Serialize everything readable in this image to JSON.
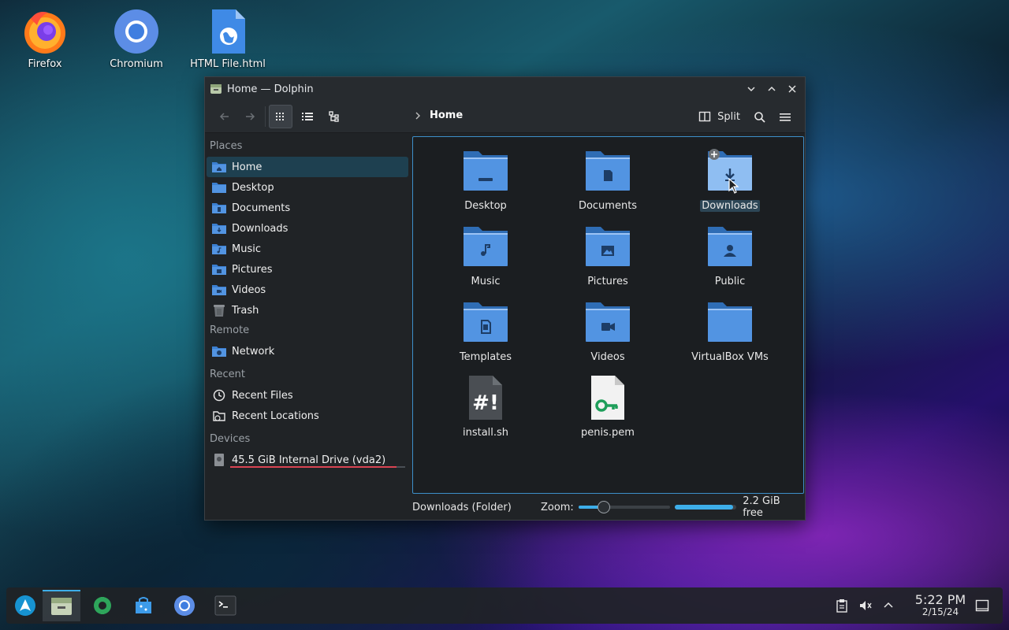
{
  "desktop": {
    "icons": [
      {
        "label": "Firefox"
      },
      {
        "label": "Chromium"
      },
      {
        "label": "HTML File.html"
      }
    ]
  },
  "window": {
    "title": "Home — Dolphin",
    "breadcrumb": "Home",
    "split_label": "Split",
    "sidebar": {
      "places_header": "Places",
      "places": [
        {
          "label": "Home",
          "icon": "home-folder-icon"
        },
        {
          "label": "Desktop",
          "icon": "desktop-folder-icon"
        },
        {
          "label": "Documents",
          "icon": "documents-folder-icon"
        },
        {
          "label": "Downloads",
          "icon": "downloads-folder-icon"
        },
        {
          "label": "Music",
          "icon": "music-folder-icon"
        },
        {
          "label": "Pictures",
          "icon": "pictures-folder-icon"
        },
        {
          "label": "Videos",
          "icon": "videos-folder-icon"
        },
        {
          "label": "Trash",
          "icon": "trash-icon"
        }
      ],
      "remote_header": "Remote",
      "remote": [
        {
          "label": "Network",
          "icon": "network-folder-icon"
        }
      ],
      "recent_header": "Recent",
      "recent": [
        {
          "label": "Recent Files",
          "icon": "clock-icon"
        },
        {
          "label": "Recent Locations",
          "icon": "recent-locations-icon"
        }
      ],
      "devices_header": "Devices",
      "devices": [
        {
          "label": "45.5 GiB Internal Drive (vda2)",
          "icon": "drive-icon",
          "usage_fraction": 0.95
        }
      ]
    },
    "files": [
      {
        "label": "Desktop",
        "icon": "desktop-folder-icon"
      },
      {
        "label": "Documents",
        "icon": "documents-folder-icon"
      },
      {
        "label": "Downloads",
        "icon": "downloads-folder-icon"
      },
      {
        "label": "Music",
        "icon": "music-folder-icon"
      },
      {
        "label": "Pictures",
        "icon": "pictures-folder-icon"
      },
      {
        "label": "Public",
        "icon": "public-folder-icon"
      },
      {
        "label": "Templates",
        "icon": "templates-folder-icon"
      },
      {
        "label": "Videos",
        "icon": "videos-folder-icon"
      },
      {
        "label": "VirtualBox VMs",
        "icon": "folder-icon"
      },
      {
        "label": "install.sh",
        "icon": "shell-script-icon"
      },
      {
        "label": "penis.pem",
        "icon": "key-file-icon"
      }
    ],
    "status": {
      "selection": "Downloads (Folder)",
      "zoom_label": "Zoom:",
      "zoom_fraction": 0.28,
      "free_space": "2.2 GiB free",
      "used_fraction": 0.95
    }
  },
  "taskbar": {
    "time": "5:22 PM",
    "date": "2/15/24"
  },
  "colors": {
    "accent": "#3daee9",
    "folder": "#5294e2",
    "folder_dark": "#2f6db5",
    "selection": "#1e4050",
    "drive_bar": "#da4453"
  }
}
